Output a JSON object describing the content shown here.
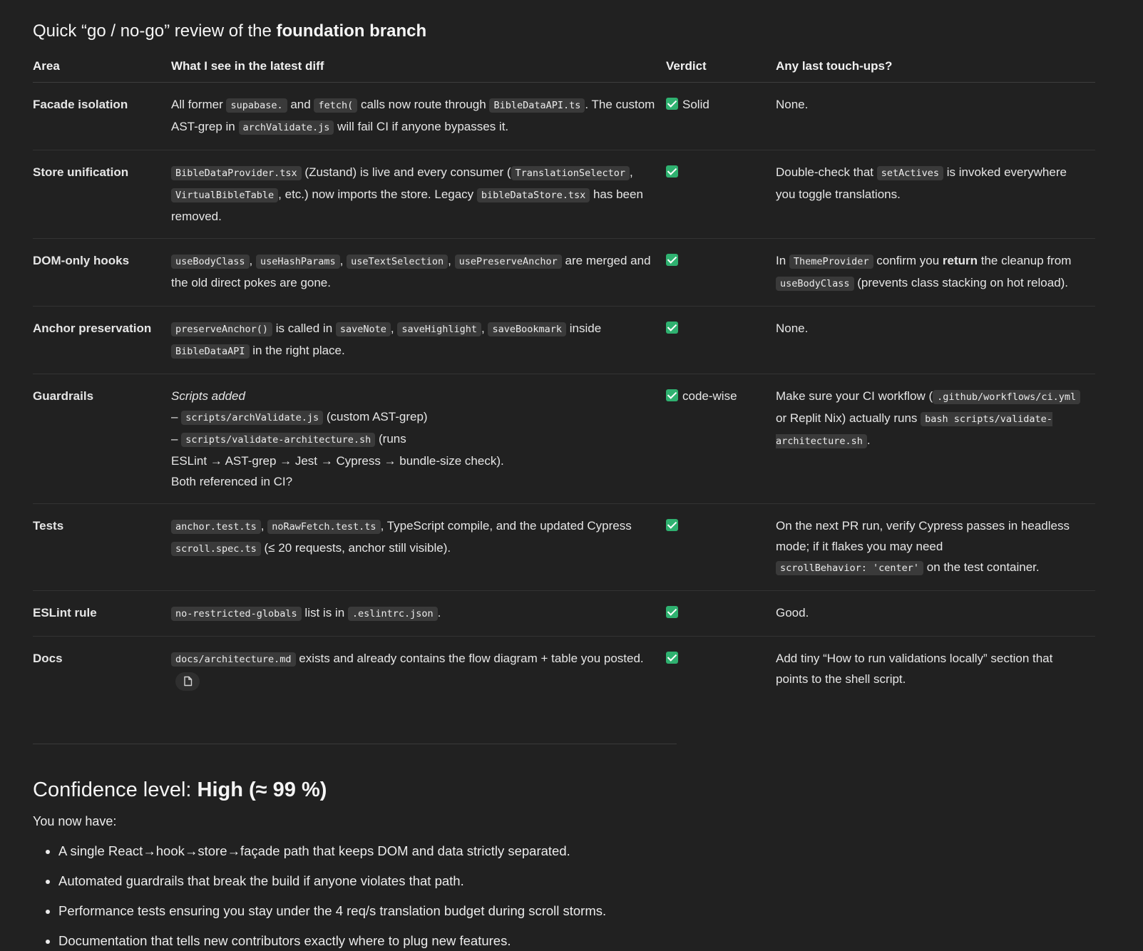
{
  "title": {
    "lead": "Quick “go / no-go” review of the ",
    "emph": "foundation branch"
  },
  "table": {
    "headers": [
      "Area",
      "What I see in the latest diff",
      "Verdict",
      "Any last touch-ups?"
    ],
    "rows": [
      {
        "area": "Facade isolation",
        "d": [
          "All former ",
          "supabase.",
          " and ",
          "fetch(",
          " calls now route through ",
          "BibleDataAPI.ts",
          ". The custom AST-grep in ",
          "archValidate.js",
          " will fail CI if anyone bypasses it."
        ],
        "verdict": "Solid",
        "t": [
          "None."
        ]
      },
      {
        "area": "Store unification",
        "d": [
          "BibleDataProvider.tsx",
          " (Zustand) is live and every consumer (",
          "TranslationSelector",
          ", ",
          "VirtualBibleTable",
          ", etc.) now imports the store. Legacy ",
          "bibleDataStore.tsx",
          " has been removed."
        ],
        "verdict": "",
        "t": [
          "Double-check that ",
          "setActives",
          " is invoked everywhere you toggle translations."
        ]
      },
      {
        "area": "DOM-only hooks",
        "d": [
          "useBodyClass",
          ", ",
          "useHashParams",
          ", ",
          "useTextSelection",
          ", ",
          "usePreserveAnchor",
          " are merged and the old direct pokes are gone."
        ],
        "verdict": "",
        "t": [
          "In ",
          "ThemeProvider",
          " confirm you ",
          "return",
          " the cleanup from ",
          "useBodyClass",
          " (prevents class stacking on hot reload)."
        ]
      },
      {
        "area": "Anchor preservation",
        "d": [
          "preserveAnchor()",
          " is called in ",
          "saveNote",
          ", ",
          "saveHighlight",
          ", ",
          "saveBookmark",
          " inside ",
          "BibleDataAPI",
          " in the right place."
        ],
        "verdict": "",
        "t": [
          "None."
        ]
      },
      {
        "area": "Guardrails",
        "d_intro": "Scripts added",
        "d_lines": [
          [
            "– ",
            "scripts/archValidate.js",
            " (custom AST-grep)"
          ],
          [
            "– ",
            "scripts/validate-architecture.sh",
            " (runs"
          ]
        ],
        "d_tail": [
          "ESLint → AST-grep → Jest → Cypress → bundle-size check).",
          "Both referenced in CI?"
        ],
        "verdict": "code-wise",
        "t": [
          "Make sure your CI workflow (",
          ".github/workflows/ci.yml",
          " or Replit Nix) actually runs ",
          "bash scripts/validate-architecture.sh",
          "."
        ]
      },
      {
        "area": "Tests",
        "d": [
          "anchor.test.ts",
          ", ",
          "noRawFetch.test.ts",
          ", TypeScript compile, and the updated Cypress ",
          "scroll.spec.ts",
          " (≤ 20 requests, anchor still visible)."
        ],
        "verdict": "",
        "t": [
          "On the next PR run, verify Cypress passes in headless mode; if it flakes you may need ",
          "scrollBehavior: 'center'",
          " on the test container."
        ]
      },
      {
        "area": "ESLint rule",
        "d": [
          "no-restricted-globals",
          " list is in ",
          ".eslintrc.json",
          "."
        ],
        "verdict": "",
        "t": [
          "Good."
        ]
      },
      {
        "area": "Docs",
        "d": [
          "docs/architecture.md",
          " exists and already contains the flow diagram + table you posted."
        ],
        "verdict": "",
        "t": [
          "Add tiny “How to run validations locally” section that points to the shell script."
        ]
      }
    ]
  },
  "confidence": {
    "label": "Confidence level: ",
    "value": "High (≈ 99 %)"
  },
  "have_intro": "You now have:",
  "bullets": [
    "A single React→hook→store→façade path that keeps DOM and data strictly separated.",
    "Automated guardrails that break the build if anyone violates that path.",
    "Performance tests ensuring you stay under the 4 req/s translation budget during scroll storms.",
    "Documentation that tells new contributors exactly where to plug new features."
  ],
  "colors": {
    "background": "#212121",
    "text": "#ececec",
    "code_bg": "#3a3a3a",
    "check": "#2fb170"
  },
  "icons": {
    "verdict": "check-mark-icon",
    "copy": "copy-icon"
  }
}
